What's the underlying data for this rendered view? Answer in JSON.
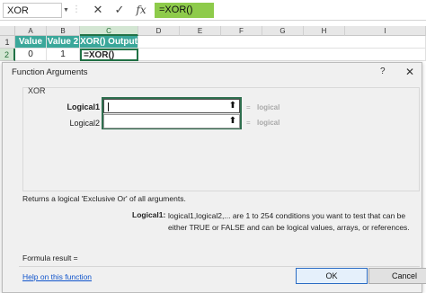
{
  "formula_bar": {
    "name_box": "XOR",
    "formula": "=XOR()",
    "cancel_icon": "✕",
    "enter_icon": "✓",
    "fx_label": "fx"
  },
  "grid": {
    "columns": [
      "A",
      "B",
      "C",
      "D",
      "E",
      "F",
      "G",
      "H",
      "I"
    ],
    "rows": [
      "1",
      "2"
    ],
    "cells": {
      "a1": "Value 1",
      "b1": "Value 2",
      "c1": "XOR() Output",
      "a2": "0",
      "b2": "1",
      "c2": "=XOR()"
    }
  },
  "dialog": {
    "title": "Function Arguments",
    "help_icon": "?",
    "close_icon": "✕",
    "function_name": "XOR",
    "args": [
      {
        "label": "Logical1",
        "value": "",
        "result": "logical"
      },
      {
        "label": "Logical2",
        "value": "",
        "result": "logical"
      }
    ],
    "equals": "=",
    "collapse_icon": "⬆",
    "description": "Returns a logical 'Exclusive Or' of all arguments.",
    "arg_help_label": "Logical1:",
    "arg_help_text": "logical1,logical2,... are 1 to 254 conditions you want to test that can be either TRUE or FALSE and can be logical values, arrays, or references.",
    "formula_result_label": "Formula result =",
    "help_link": "Help on this function",
    "ok_label": "OK",
    "cancel_label": "Cancel"
  },
  "colors": {
    "header_fill": "#3aa79a",
    "formula_highlight": "#8ecb4b",
    "excel_green": "#217346"
  }
}
